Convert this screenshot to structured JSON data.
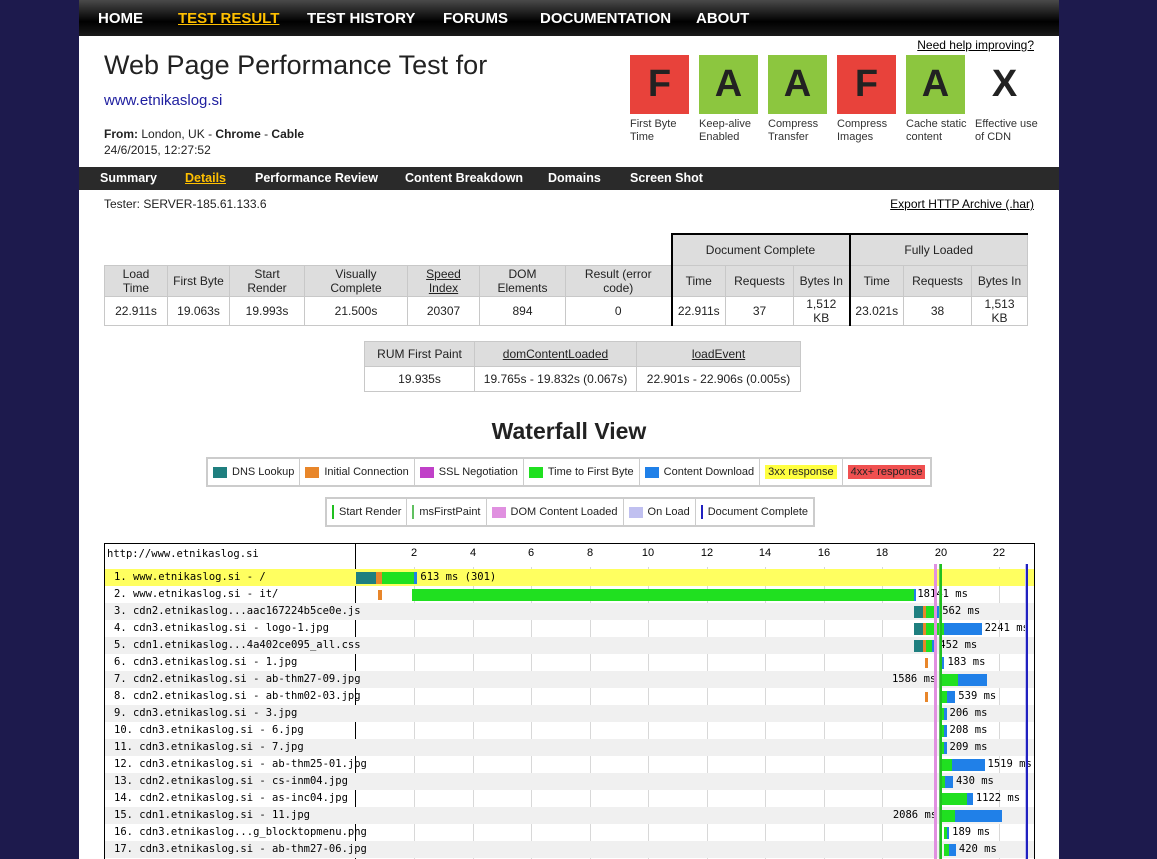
{
  "topnav": [
    {
      "label": "HOME",
      "active": false
    },
    {
      "label": "TEST RESULT",
      "active": true
    },
    {
      "label": "TEST HISTORY",
      "active": false
    },
    {
      "label": "FORUMS",
      "active": false
    },
    {
      "label": "DOCUMENTATION",
      "active": false
    },
    {
      "label": "ABOUT",
      "active": false
    }
  ],
  "header": {
    "help_link": "Need help improving?",
    "title": "Web Page Performance Test for",
    "url": "www.etnikaslog.si",
    "from_label": "From:",
    "from_location": "London, UK",
    "from_browser": "Chrome",
    "from_connection": "Cable",
    "date": "24/6/2015, 12:27:52"
  },
  "grades": [
    {
      "grade": "F",
      "label": "First Byte Time",
      "color": "#e8423b"
    },
    {
      "grade": "A",
      "label": "Keep-alive Enabled",
      "color": "#8cc63f"
    },
    {
      "grade": "A",
      "label": "Compress Transfer",
      "color": "#8cc63f"
    },
    {
      "grade": "F",
      "label": "Compress Images",
      "color": "#e8423b"
    },
    {
      "grade": "A",
      "label": "Cache static content",
      "color": "#8cc63f"
    },
    {
      "grade": "X",
      "label": "Effective use of CDN",
      "color": "#ffffff"
    }
  ],
  "subnav": [
    {
      "label": "Summary",
      "active": false
    },
    {
      "label": "Details",
      "active": true
    },
    {
      "label": "Performance Review",
      "active": false
    },
    {
      "label": "Content Breakdown",
      "active": false
    },
    {
      "label": "Domains",
      "active": false
    },
    {
      "label": "Screen Shot",
      "active": false
    }
  ],
  "tester": "Tester: SERVER-185.61.133.6",
  "export_link": "Export HTTP Archive (.har)",
  "results": {
    "group_doc": "Document Complete",
    "group_full": "Fully Loaded",
    "headers": [
      "Load Time",
      "First Byte",
      "Start Render",
      "Visually Complete",
      "Speed Index",
      "DOM Elements",
      "Result (error code)",
      "Time",
      "Requests",
      "Bytes In",
      "Time",
      "Requests",
      "Bytes In"
    ],
    "values": [
      "22.911s",
      "19.063s",
      "19.993s",
      "21.500s",
      "20307",
      "894",
      "0",
      "22.911s",
      "37",
      "1,512 KB",
      "23.021s",
      "38",
      "1,513 KB"
    ]
  },
  "rum": {
    "headers": [
      "RUM First Paint",
      "domContentLoaded",
      "loadEvent"
    ],
    "values": [
      "19.935s",
      "19.765s - 19.832s (0.067s)",
      "22.901s - 22.906s (0.005s)"
    ]
  },
  "waterfall_title": "Waterfall View",
  "legend1": [
    {
      "label": "DNS Lookup",
      "color": "#1f7f7f"
    },
    {
      "label": "Initial Connection",
      "color": "#e8862a"
    },
    {
      "label": "SSL Negotiation",
      "color": "#c040c8"
    },
    {
      "label": "Time to First Byte",
      "color": "#20e020"
    },
    {
      "label": "Content Download",
      "color": "#2080e8"
    },
    {
      "label": "3xx response",
      "color": "#ffff40"
    },
    {
      "label": "4xx+ response",
      "color": "#f05050"
    }
  ],
  "legend2": [
    {
      "label": "Start Render",
      "color": "#20c020"
    },
    {
      "label": "msFirstPaint",
      "color": "#60c060"
    },
    {
      "label": "DOM Content Loaded",
      "color": "#e090e0"
    },
    {
      "label": "On Load",
      "color": "#c0c0f0"
    },
    {
      "label": "Document Complete",
      "color": "#2020c0"
    }
  ],
  "waterfall": {
    "page_url": "http://www.etnikaslog.si",
    "axis": [
      2,
      4,
      6,
      8,
      10,
      12,
      14,
      16,
      18,
      20,
      22
    ],
    "max_seconds": 23.021,
    "start_render": 19.993,
    "first_paint": 19.935,
    "dom_content_loaded": [
      19.765,
      19.832
    ],
    "on_load": [
      22.901,
      22.906
    ],
    "doc_complete": 22.911,
    "rows": [
      {
        "label": "1. www.etnikaslog.si - /",
        "time": "613 ms (301)",
        "highlight": true,
        "dns": [
          0,
          0.7
        ],
        "conn": [
          0.7,
          0.9
        ],
        "ttfb": [
          0.9,
          2.0
        ],
        "dl": [
          2.0,
          2.1
        ]
      },
      {
        "label": "2. www.etnikaslog.si - it/",
        "time": "18141 ms",
        "conn_only": [
          0.75,
          0.9
        ],
        "ttfb": [
          1.9,
          19.08
        ],
        "dl": [
          19.08,
          19.1
        ]
      },
      {
        "label": "3. cdn2.etnikaslog...aac167224b5ce0e.js",
        "time": "562 ms",
        "dns": [
          19.1,
          19.4
        ],
        "conn": [
          19.4,
          19.5
        ],
        "ttfb": [
          19.5,
          19.8
        ],
        "dl": [
          19.8,
          19.95
        ]
      },
      {
        "label": "4. cdn3.etnikaslog.si - logo-1.jpg",
        "time": "2241 ms",
        "dns": [
          19.1,
          19.4
        ],
        "conn": [
          19.4,
          19.5
        ],
        "ttfb": [
          19.5,
          20.1
        ],
        "dl": [
          20.1,
          21.4
        ]
      },
      {
        "label": "5. cdn1.etnikaslog...4a402ce095_all.css",
        "time": "452 ms",
        "dns": [
          19.1,
          19.4
        ],
        "conn": [
          19.4,
          19.5
        ],
        "ttfb": [
          19.5,
          19.7
        ],
        "dl": [
          19.7,
          19.85
        ]
      },
      {
        "label": "6. cdn3.etnikaslog.si - 1.jpg",
        "time": "183 ms",
        "conn_only": [
          19.48,
          19.55
        ],
        "ttfb": [
          19.95,
          20.05
        ],
        "dl": [
          20.05,
          20.13
        ]
      },
      {
        "label": "7. cdn2.etnikaslog.si - ab-thm27-09.jpg",
        "time": "1586 ms",
        "time_left": true,
        "ttfb": [
          19.95,
          20.6
        ],
        "dl": [
          20.6,
          21.6
        ]
      },
      {
        "label": "8. cdn2.etnikaslog.si - ab-thm02-03.jpg",
        "time": "539 ms",
        "conn_only": [
          19.48,
          19.55
        ],
        "ttfb": [
          19.95,
          20.2
        ],
        "dl": [
          20.2,
          20.5
        ]
      },
      {
        "label": "9. cdn3.etnikaslog.si - 3.jpg",
        "time": "206 ms",
        "ttfb": [
          19.98,
          20.1
        ],
        "dl": [
          20.1,
          20.2
        ]
      },
      {
        "label": "10. cdn3.etnikaslog.si - 6.jpg",
        "time": "208 ms",
        "ttfb": [
          19.98,
          20.1
        ],
        "dl": [
          20.1,
          20.2
        ]
      },
      {
        "label": "11. cdn3.etnikaslog.si - 7.jpg",
        "time": "209 ms",
        "ttfb": [
          19.98,
          20.1
        ],
        "dl": [
          20.1,
          20.2
        ]
      },
      {
        "label": "12. cdn3.etnikaslog.si - ab-thm25-01.jpg",
        "time": "1519 ms",
        "ttfb": [
          19.98,
          20.4
        ],
        "dl": [
          20.4,
          21.5
        ]
      },
      {
        "label": "13. cdn2.etnikaslog.si - cs-inm04.jpg",
        "time": "430 ms",
        "ttfb": [
          19.98,
          20.15
        ],
        "dl": [
          20.15,
          20.42
        ]
      },
      {
        "label": "14. cdn2.etnikaslog.si - as-inc04.jpg",
        "time": "1122 ms",
        "ttfb": [
          19.98,
          20.9
        ],
        "dl": [
          20.9,
          21.1
        ]
      },
      {
        "label": "15. cdn1.etnikaslog.si - 11.jpg",
        "time": "2086 ms",
        "time_left": true,
        "ttfb": [
          19.98,
          20.5
        ],
        "dl": [
          20.5,
          22.1
        ]
      },
      {
        "label": "16. cdn3.etnikaslog...g_blocktopmenu.png",
        "time": "189 ms",
        "ttfb": [
          20.1,
          20.22
        ],
        "dl": [
          20.22,
          20.29
        ]
      },
      {
        "label": "17. cdn3.etnikaslog.si - ab-thm27-06.jpg",
        "time": "420 ms",
        "ttfb": [
          20.1,
          20.3
        ],
        "dl": [
          20.3,
          20.52
        ]
      }
    ]
  }
}
